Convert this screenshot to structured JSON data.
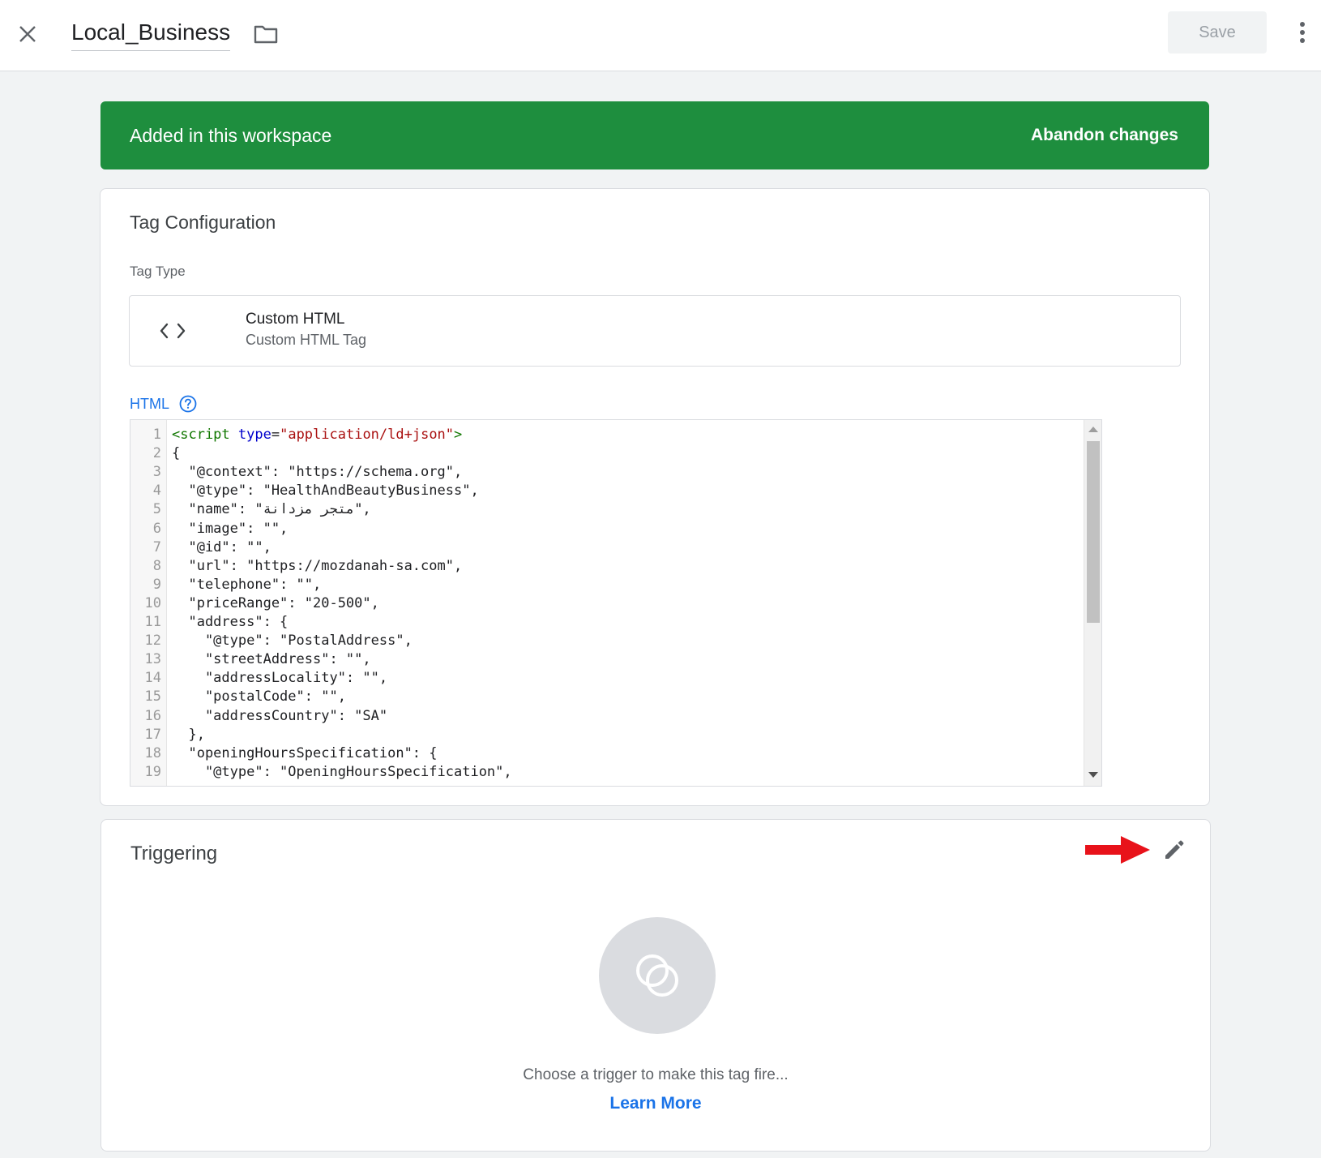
{
  "header": {
    "title": "Local_Business",
    "save_label": "Save",
    "close_icon": "close-icon",
    "folder_icon": "folder-icon",
    "more_icon": "more-vert-icon"
  },
  "banner": {
    "text": "Added in this workspace",
    "action": "Abandon changes",
    "color": "#1e8e3e"
  },
  "tag_configuration": {
    "title": "Tag Configuration",
    "tag_type_label": "Tag Type",
    "tag_type": {
      "icon": "code-brackets-icon",
      "name": "Custom HTML",
      "subtitle": "Custom HTML Tag"
    },
    "html_label": "HTML",
    "editor_lines": [
      {
        "n": "1"
      },
      {
        "n": "2",
        "text": "{"
      },
      {
        "n": "3",
        "text": "  \"@context\": \"https://schema.org\","
      },
      {
        "n": "4",
        "text": "  \"@type\": \"HealthAndBeautyBusiness\","
      },
      {
        "n": "5",
        "text": "  \"name\": \"متجر مزدانة\","
      },
      {
        "n": "6",
        "text": "  \"image\": \"\","
      },
      {
        "n": "7",
        "text": "  \"@id\": \"\","
      },
      {
        "n": "8",
        "text": "  \"url\": \"https://mozdanah-sa.com\","
      },
      {
        "n": "9",
        "text": "  \"telephone\": \"\","
      },
      {
        "n": "10",
        "text": "  \"priceRange\": \"20-500\","
      },
      {
        "n": "11",
        "text": "  \"address\": {"
      },
      {
        "n": "12",
        "text": "    \"@type\": \"PostalAddress\","
      },
      {
        "n": "13",
        "text": "    \"streetAddress\": \"\","
      },
      {
        "n": "14",
        "text": "    \"addressLocality\": \"\","
      },
      {
        "n": "15",
        "text": "    \"postalCode\": \"\","
      },
      {
        "n": "16",
        "text": "    \"addressCountry\": \"SA\""
      },
      {
        "n": "17",
        "text": "  },"
      },
      {
        "n": "18",
        "text": "  \"openingHoursSpecification\": {"
      },
      {
        "n": "19",
        "text": "    \"@type\": \"OpeningHoursSpecification\","
      }
    ],
    "line1_tokens": {
      "open": "<script ",
      "attr": "type",
      "eq": "=",
      "val": "\"application/ld+json\"",
      "close": ">"
    }
  },
  "triggering": {
    "title": "Triggering",
    "hint": "Choose a trigger to make this tag fire...",
    "learn_more": "Learn More",
    "arrow_color": "#e8121a"
  }
}
